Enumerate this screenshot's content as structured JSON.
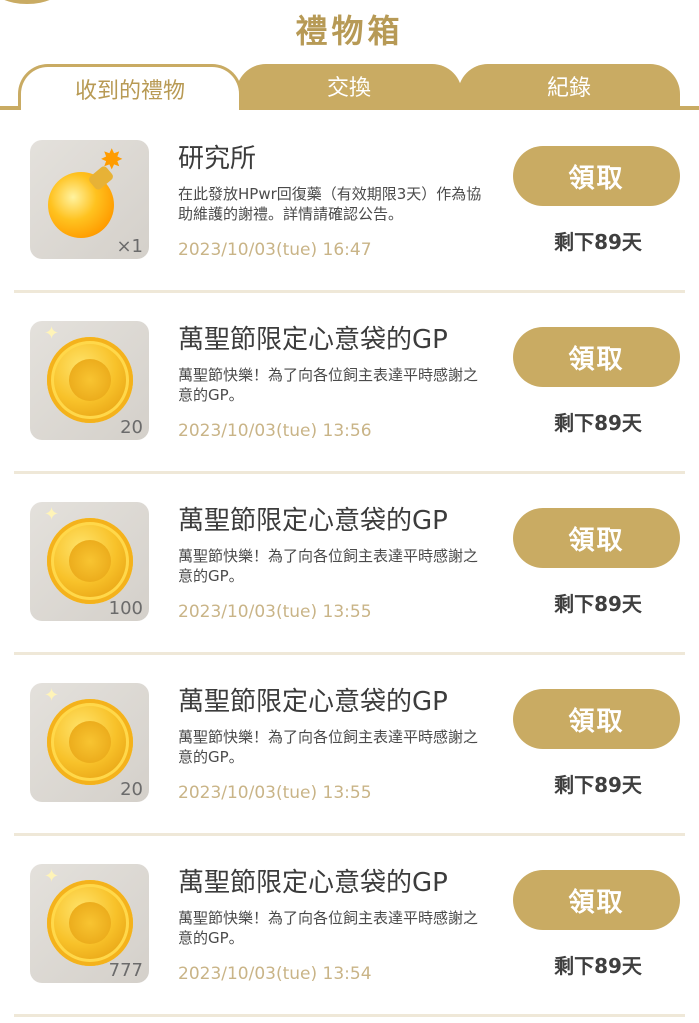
{
  "header": {
    "title": "禮物箱"
  },
  "tabs": [
    {
      "label": "收到的禮物",
      "active": true
    },
    {
      "label": "交換",
      "active": false
    },
    {
      "label": "紀錄",
      "active": false
    }
  ],
  "colors": {
    "accent": "#c9ab63",
    "title": "#b79a56",
    "date": "#c9b487"
  },
  "gifts": [
    {
      "icon": "potion-icon",
      "quantity": "×1",
      "name": "研究所",
      "description": "在此發放HPwr回復藥（有效期限3天）作為協助維護的謝禮。詳情請確認公告。",
      "date": "2023/10/03(tue) 16:47",
      "claim_label": "領取",
      "remaining": "剩下89天"
    },
    {
      "icon": "gold-coin-icon",
      "quantity": "20",
      "name": "萬聖節限定心意袋的GP",
      "description": "萬聖節快樂！為了向各位飼主表達平時感謝之意的GP。",
      "date": "2023/10/03(tue) 13:56",
      "claim_label": "領取",
      "remaining": "剩下89天"
    },
    {
      "icon": "gold-coin-icon",
      "quantity": "100",
      "name": "萬聖節限定心意袋的GP",
      "description": "萬聖節快樂！為了向各位飼主表達平時感謝之意的GP。",
      "date": "2023/10/03(tue) 13:55",
      "claim_label": "領取",
      "remaining": "剩下89天"
    },
    {
      "icon": "gold-coin-icon",
      "quantity": "20",
      "name": "萬聖節限定心意袋的GP",
      "description": "萬聖節快樂！為了向各位飼主表達平時感謝之意的GP。",
      "date": "2023/10/03(tue) 13:55",
      "claim_label": "領取",
      "remaining": "剩下89天"
    },
    {
      "icon": "gold-coin-icon",
      "quantity": "777",
      "name": "萬聖節限定心意袋的GP",
      "description": "萬聖節快樂！為了向各位飼主表達平時感謝之意的GP。",
      "date": "2023/10/03(tue) 13:54",
      "claim_label": "領取",
      "remaining": "剩下89天"
    }
  ]
}
